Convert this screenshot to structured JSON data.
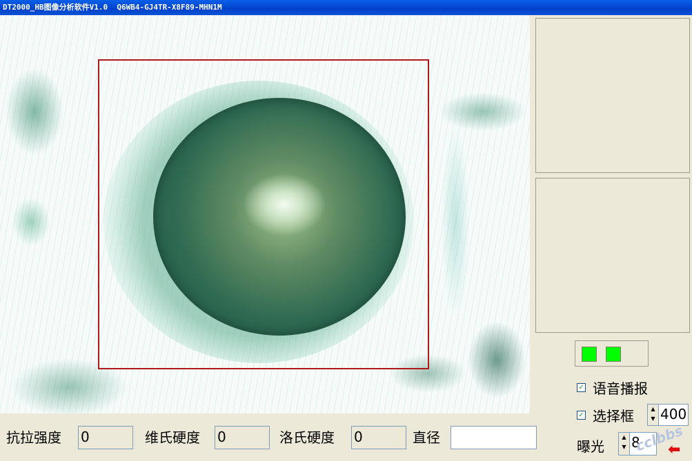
{
  "window": {
    "title": "DT2000_HB图像分析软件V1.0  Q6WB4-GJ4TR-X8F89-MHN1M"
  },
  "options": {
    "voice_broadcast_label": "语音播报",
    "voice_broadcast_checked": true,
    "select_frame_label": "选择框",
    "select_frame_checked": true,
    "select_frame_value": "400",
    "exposure_label": "曝光",
    "exposure_value": "8"
  },
  "results": {
    "tensile_label": "抗拉强度",
    "tensile_value": "0",
    "vickers_label": "维氏硬度",
    "vickers_value": "0",
    "rockwell_label": "洛氏硬度",
    "rockwell_value": "0",
    "diameter_label": "直径",
    "diameter_value": ""
  },
  "indicators": {
    "color": "#00ff00",
    "count": 2
  },
  "watermark": "cclbbs",
  "icons": {
    "check": "✓",
    "spin_up": "▲",
    "spin_down": "▼",
    "back": "arrow-left-icon"
  }
}
